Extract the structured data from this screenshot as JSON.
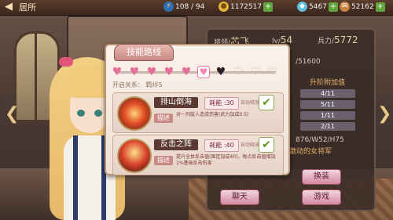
{
  "topbar": {
    "title": "居所",
    "stamina": "108 / 94",
    "gold": "1172517",
    "gems": "5467",
    "currency2": "52162",
    "plus": "+"
  },
  "info_panel": {
    "general_label": "将领/",
    "general_name": "芯飞",
    "level_label": "lv/",
    "level_value": "54",
    "power_label": "兵力/",
    "power_value": "5772",
    "exp": "/51600",
    "bonus_header": "升阶附加值",
    "stats": [
      "4/11",
      "5/11",
      "1/11",
      "2/11"
    ],
    "extra_line": "876/W52/H75",
    "bio": "激动的女将军",
    "buttons": {
      "swap": "换装",
      "chat": "聊天",
      "game": "游戏"
    }
  },
  "popup": {
    "title": "技能路线",
    "unlock_text": "开启关系：  羁绊5",
    "hearts": [
      "on",
      "on",
      "on",
      "on",
      "on",
      "cur",
      "off",
      "empty",
      "empty",
      "empty"
    ],
    "skills": [
      {
        "name": "排山倒海",
        "cost": "耗能 :30",
        "auto": "自动释放",
        "desc_label": "描述",
        "desc": "对一列敌人造成伤害(武力加成0.5)"
      },
      {
        "name": "反击之阵",
        "cost": "耗能 :40",
        "auto": "自动释放",
        "desc_label": "描述",
        "desc": "提升全体反击值(固定加成40)，每点反击值增加1%基础反击伤害"
      }
    ]
  }
}
